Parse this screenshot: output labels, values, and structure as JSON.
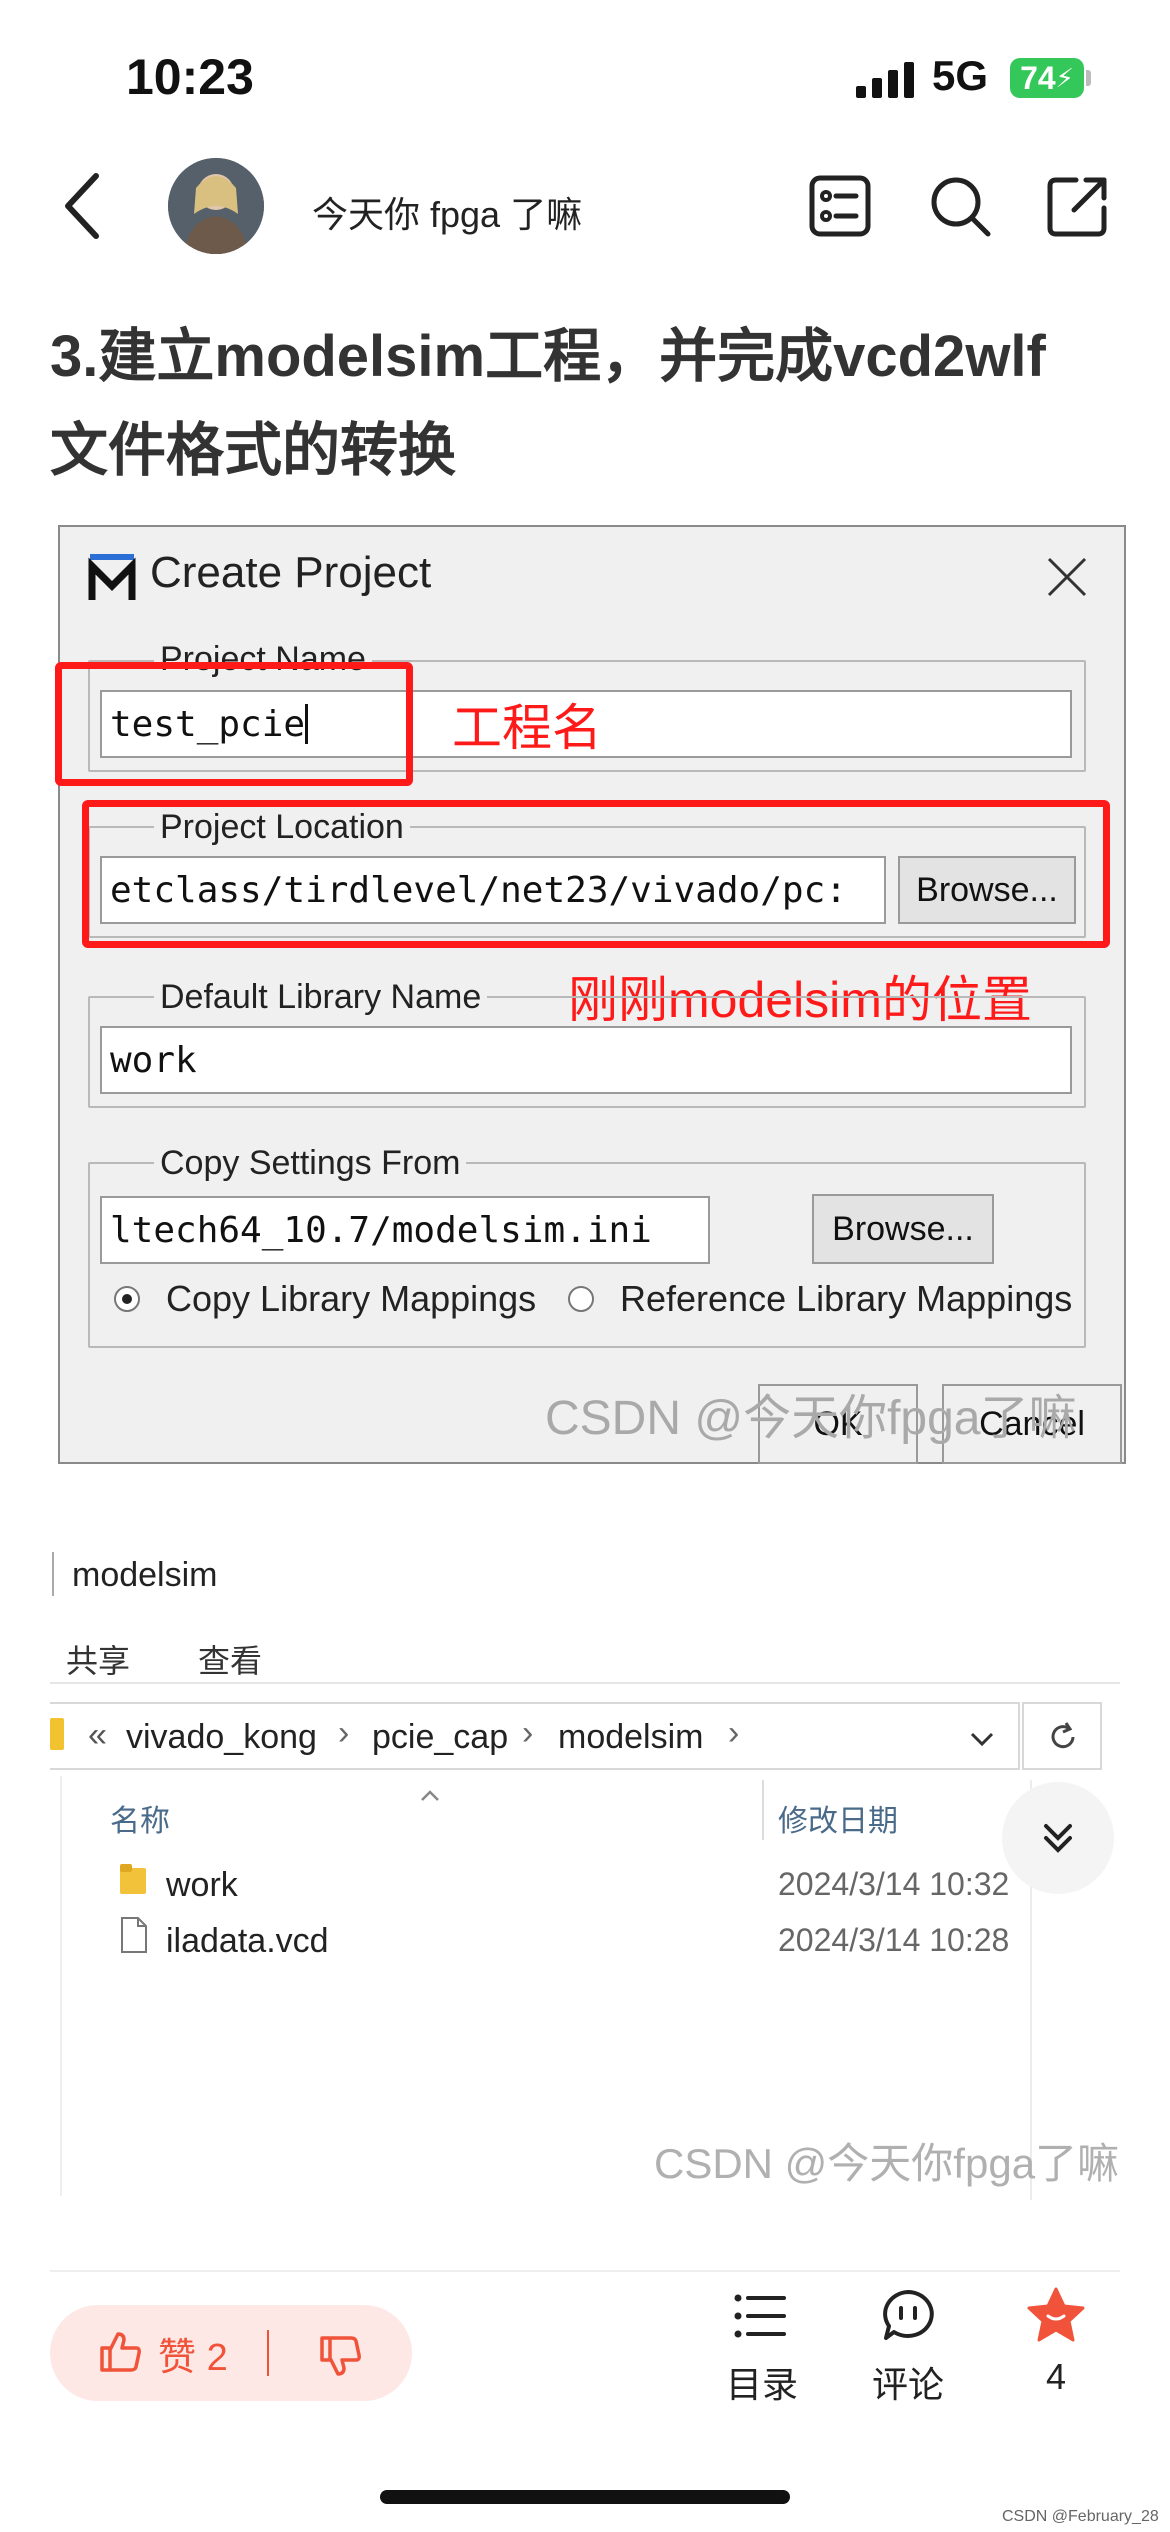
{
  "status_bar": {
    "time": "10:23",
    "network": "5G",
    "battery": "74"
  },
  "header": {
    "author": "今天你 fpga 了嘛"
  },
  "article": {
    "title": "3.建立modelsim工程，并完成vcd2wlf文件格式的转换"
  },
  "dialog": {
    "title": "Create Project",
    "project_name_label": "Project Name",
    "project_name_value": "test_pcie",
    "project_location_label": "Project Location",
    "project_location_value": "etclass/tirdlevel/net23/vivado/pc:",
    "browse_label": "Browse...",
    "default_library_label": "Default Library Name",
    "default_library_value": "work",
    "copy_settings_label": "Copy Settings From",
    "copy_settings_value": "ltech64_10.7/modelsim.ini",
    "copy_mappings_label": "Copy Library Mappings",
    "reference_mappings_label": "Reference Library Mappings",
    "ok_label": "OK",
    "cancel_label": "Cancel",
    "annotation_project_name": "工程名",
    "annotation_location": "刚刚modelsim的位置",
    "watermark": "CSDN @今天你fpga了嘛"
  },
  "explorer": {
    "window_title": "modelsim",
    "menu": [
      "共享",
      "查看"
    ],
    "breadcrumb": [
      "vivado_kong",
      "pcie_cap",
      "modelsim"
    ],
    "breadcrumb_prefix": "«",
    "col_name": "名称",
    "col_modified": "修改日期",
    "files": [
      {
        "name": "work",
        "date": "2024/3/14 10:32",
        "icon": "folder-icon"
      },
      {
        "name": "iladata.vcd",
        "date": "2024/3/14 10:28",
        "icon": "file-icon"
      }
    ],
    "watermark": "CSDN @今天你fpga了嘛"
  },
  "bottom_bar": {
    "like_label": "赞",
    "like_count": "2",
    "toc_label": "目录",
    "comment_label": "评论",
    "favorite_count": "4"
  },
  "corner_watermark": "CSDN @February_28",
  "colors": {
    "accent": "#f0533a",
    "annotation_red": "#ff1a1a",
    "battery_green": "#34c759"
  }
}
